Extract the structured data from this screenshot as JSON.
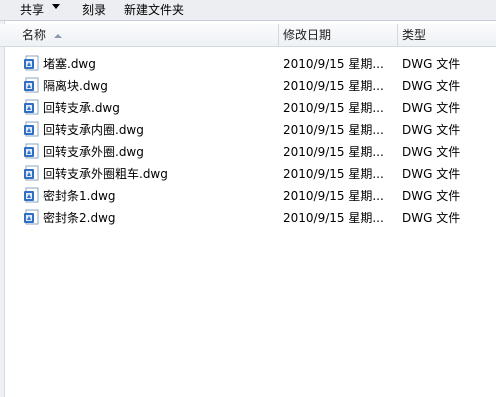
{
  "toolbar": {
    "share_label": "共享",
    "burn_label": "刻录",
    "new_folder_label": "新建文件夹"
  },
  "columns": {
    "name": "名称",
    "date_modified": "修改日期",
    "type": "类型"
  },
  "colors": {
    "icon_blue": "#2f6fc4",
    "icon_light": "#dfe9f7"
  },
  "files": [
    {
      "name": "堵塞.dwg",
      "date": "2010/9/15 星期...",
      "type": "DWG 文件",
      "icon": "dwg-file-icon"
    },
    {
      "name": "隔离块.dwg",
      "date": "2010/9/15 星期...",
      "type": "DWG 文件",
      "icon": "dwg-file-icon"
    },
    {
      "name": "回转支承.dwg",
      "date": "2010/9/15 星期...",
      "type": "DWG 文件",
      "icon": "dwg-file-icon"
    },
    {
      "name": "回转支承内圈.dwg",
      "date": "2010/9/15 星期...",
      "type": "DWG 文件",
      "icon": "dwg-file-icon"
    },
    {
      "name": "回转支承外圈.dwg",
      "date": "2010/9/15 星期...",
      "type": "DWG 文件",
      "icon": "dwg-file-icon"
    },
    {
      "name": "回转支承外圈粗车.dwg",
      "date": "2010/9/15 星期...",
      "type": "DWG 文件",
      "icon": "dwg-file-icon"
    },
    {
      "name": "密封条1.dwg",
      "date": "2010/9/15 星期...",
      "type": "DWG 文件",
      "icon": "dwg-file-icon"
    },
    {
      "name": "密封条2.dwg",
      "date": "2010/9/15 星期...",
      "type": "DWG 文件",
      "icon": "dwg-file-icon"
    }
  ]
}
